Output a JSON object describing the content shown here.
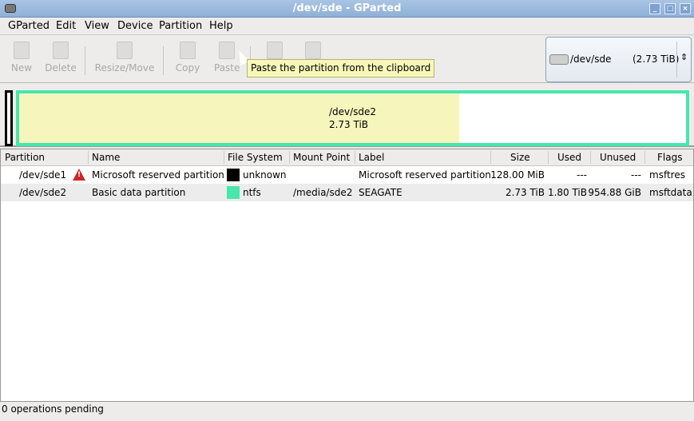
{
  "window": {
    "title": "/dev/sde - GParted"
  },
  "menu": [
    "GParted",
    "Edit",
    "View",
    "Device",
    "Partition",
    "Help"
  ],
  "toolbar": {
    "new": "New",
    "delete": "Delete",
    "resize": "Resize/Move",
    "copy": "Copy",
    "paste": "Paste"
  },
  "tooltip": "Paste the partition from the clipboard",
  "device": {
    "name": "/dev/sde",
    "size": "(2.73 TiB)"
  },
  "diskmap": {
    "name": "/dev/sde2",
    "size": "2.73 TiB",
    "used_fraction": 0.66
  },
  "columns": [
    "Partition",
    "Name",
    "File System",
    "Mount Point",
    "Label",
    "Size",
    "Used",
    "Unused",
    "Flags"
  ],
  "rows": [
    {
      "partition": "/dev/sde1",
      "warning": true,
      "name": "Microsoft reserved partition",
      "fs": "unknown",
      "fs_color": "#000000",
      "mount": "",
      "label": "Microsoft reserved partition",
      "size": "128.00 MiB",
      "used": "---",
      "unused": "---",
      "flags": "msftres"
    },
    {
      "partition": "/dev/sde2",
      "warning": false,
      "name": "Basic data partition",
      "fs": "ntfs",
      "fs_color": "#47e6ad",
      "mount": "/media/sde2",
      "label": "SEAGATE",
      "size": "2.73 TiB",
      "used": "1.80 TiB",
      "unused": "954.88 GiB",
      "flags": "msftdata"
    }
  ],
  "status": "0 operations pending"
}
